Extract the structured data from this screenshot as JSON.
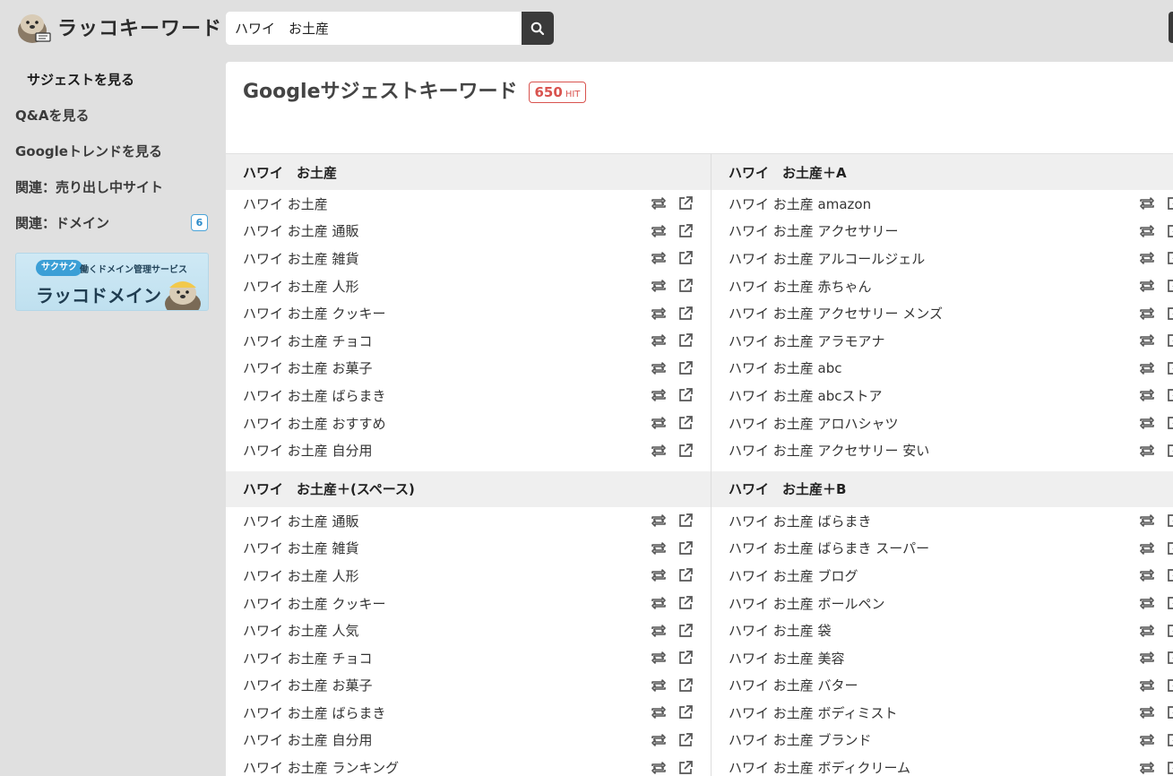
{
  "header": {
    "logo_text": "ラッコキーワード",
    "search_value": "ハワイ　お土産"
  },
  "sidebar": {
    "items": [
      {
        "label": "サジェストを見る"
      },
      {
        "label": "Q&Aを見る"
      },
      {
        "label": "Googleトレンドを見る"
      },
      {
        "label": "関連：売り出し中サイト"
      },
      {
        "label": "関連：ドメイン",
        "badge": "6"
      }
    ],
    "banner": {
      "tag": "サクサク",
      "sub": "働くドメイン管理サービス",
      "title": "ラッコドメイン"
    }
  },
  "main": {
    "title": "Googleサジェストキーワード",
    "hit_count": "650",
    "hit_label": "HIT"
  },
  "groups_left": [
    {
      "title": "ハワイ　お土産",
      "items": [
        "ハワイ お土産",
        "ハワイ お土産 通販",
        "ハワイ お土産 雑貨",
        "ハワイ お土産 人形",
        "ハワイ お土産 クッキー",
        "ハワイ お土産 チョコ",
        "ハワイ お土産 お菓子",
        "ハワイ お土産 ばらまき",
        "ハワイ お土産 おすすめ",
        "ハワイ お土産 自分用"
      ]
    },
    {
      "title": "ハワイ　お土産＋(スペース)",
      "items": [
        "ハワイ お土産 通販",
        "ハワイ お土産 雑貨",
        "ハワイ お土産 人形",
        "ハワイ お土産 クッキー",
        "ハワイ お土産 人気",
        "ハワイ お土産 チョコ",
        "ハワイ お土産 お菓子",
        "ハワイ お土産 ばらまき",
        "ハワイ お土産 自分用",
        "ハワイ お土産 ランキング"
      ]
    }
  ],
  "groups_right": [
    {
      "title": "ハワイ　お土産＋A",
      "items": [
        "ハワイ お土産 amazon",
        "ハワイ お土産 アクセサリー",
        "ハワイ お土産 アルコールジェル",
        "ハワイ お土産 赤ちゃん",
        "ハワイ お土産 アクセサリー メンズ",
        "ハワイ お土産 アラモアナ",
        "ハワイ お土産 abc",
        "ハワイ お土産 abcストア",
        "ハワイ お土産 アロハシャツ",
        "ハワイ お土産 アクセサリー 安い"
      ]
    },
    {
      "title": "ハワイ　お土産＋B",
      "items": [
        "ハワイ お土産 ばらまき",
        "ハワイ お土産 ばらまき スーパー",
        "ハワイ お土産 ブログ",
        "ハワイ お土産 ボールペン",
        "ハワイ お土産 袋",
        "ハワイ お土産 美容",
        "ハワイ お土産 バター",
        "ハワイ お土産 ボディミスト",
        "ハワイ お土産 ブランド",
        "ハワイ お土産 ボディクリーム"
      ]
    }
  ],
  "icons": {
    "search": "search-icon",
    "retweet": "retweet-icon",
    "external": "external-link-icon"
  },
  "colors": {
    "hit_badge": "#d9534f",
    "sidebar_badge": "#4aa3d8",
    "search_button": "#3a3a3a"
  }
}
